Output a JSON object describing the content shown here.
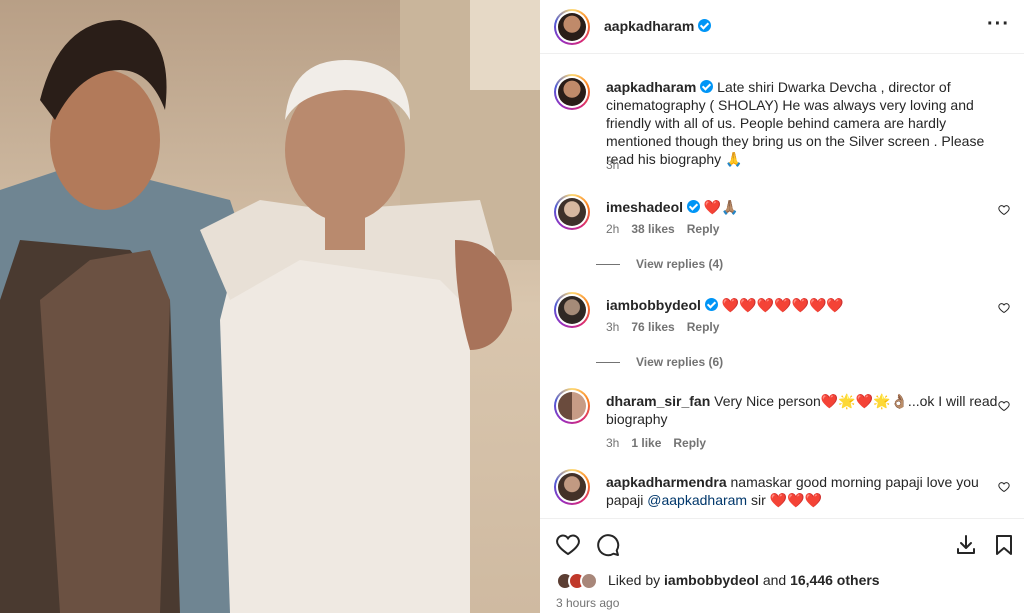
{
  "header": {
    "username": "aapkadharam"
  },
  "caption": {
    "username": "aapkadharam",
    "text": "Late shiri Dwarka Devcha , director of cinematography ( SHOLAY) He was always very loving and friendly with all of us. People behind camera are hardly mentioned though they bring us on the Silver screen . Please read his biography 🙏",
    "time": "3h"
  },
  "comments": [
    {
      "username": "imeshadeol",
      "text": "❤️🙏🏽",
      "time": "2h",
      "likes": "38 likes",
      "reply": "Reply",
      "view_replies": "View replies (4)"
    },
    {
      "username": "iambobbydeol",
      "text": "❤️❤️❤️❤️❤️❤️❤️",
      "time": "3h",
      "likes": "76 likes",
      "reply": "Reply",
      "view_replies": "View replies (6)"
    },
    {
      "username": "dharam_sir_fan",
      "text": "Very Nice person❤️🌟❤️🌟👌🏽...ok I will read biography",
      "time": "3h",
      "likes": "1 like",
      "reply": "Reply"
    },
    {
      "username": "aapkadharmendra",
      "text_before": "namaskar good morning papaji love you papaji ",
      "mention": "@aapkadharam",
      "text_after": " sir ❤️❤️❤️"
    }
  ],
  "footer": {
    "liked_by_prefix": "Liked by ",
    "liked_by_user": "iambobbydeol",
    "and": " and ",
    "others": "16,446 others",
    "timestamp": "3 hours ago"
  },
  "icons": [
    "heart-icon",
    "comment-icon",
    "download-icon",
    "bookmark-icon",
    "more-icon",
    "verified-icon"
  ],
  "colors": {
    "verified": "#0095f6",
    "heart": "#ed4956",
    "mention": "#00376b",
    "muted": "#737373"
  }
}
